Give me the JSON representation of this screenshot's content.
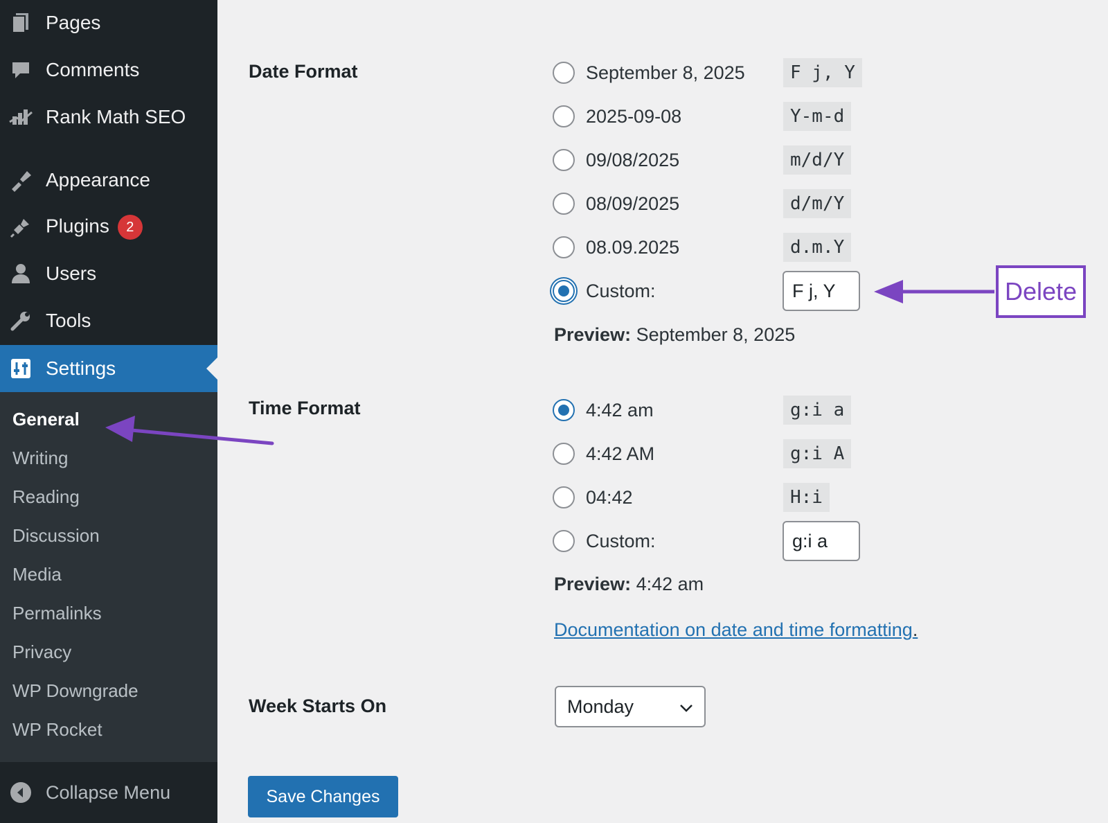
{
  "sidebar": {
    "menu": [
      {
        "label": "Pages",
        "icon": "pages-icon"
      },
      {
        "label": "Comments",
        "icon": "comments-icon"
      },
      {
        "label": "Rank Math SEO",
        "icon": "rank-math-icon"
      },
      {
        "label": "Appearance",
        "icon": "appearance-icon"
      },
      {
        "label": "Plugins",
        "icon": "plugins-icon",
        "badge": "2"
      },
      {
        "label": "Users",
        "icon": "users-icon"
      },
      {
        "label": "Tools",
        "icon": "tools-icon"
      },
      {
        "label": "Settings",
        "icon": "settings-icon",
        "active": true
      }
    ],
    "submenu": [
      {
        "label": "General",
        "current": true
      },
      {
        "label": "Writing"
      },
      {
        "label": "Reading"
      },
      {
        "label": "Discussion"
      },
      {
        "label": "Media"
      },
      {
        "label": "Permalinks"
      },
      {
        "label": "Privacy"
      },
      {
        "label": "WP Downgrade"
      },
      {
        "label": "WP Rocket"
      }
    ],
    "collapse_label": "Collapse Menu"
  },
  "date_format": {
    "label": "Date Format",
    "options": [
      {
        "display": "September 8, 2025",
        "code": "F j, Y"
      },
      {
        "display": "2025-09-08",
        "code": "Y-m-d"
      },
      {
        "display": "09/08/2025",
        "code": "m/d/Y"
      },
      {
        "display": "08/09/2025",
        "code": "d/m/Y"
      },
      {
        "display": "08.09.2025",
        "code": "d.m.Y"
      }
    ],
    "custom_label": "Custom:",
    "custom_value": "F j, Y",
    "preview_label": "Preview:",
    "preview_value": "September 8, 2025"
  },
  "time_format": {
    "label": "Time Format",
    "options": [
      {
        "display": "4:42 am",
        "code": "g:i a"
      },
      {
        "display": "4:42 AM",
        "code": "g:i A"
      },
      {
        "display": "04:42",
        "code": "H:i"
      }
    ],
    "custom_label": "Custom:",
    "custom_value": "g:i a",
    "preview_label": "Preview:",
    "preview_value": "4:42 am"
  },
  "documentation_link": "Documentation on date and time formatting",
  "documentation_period": ".",
  "week_starts_on": {
    "label": "Week Starts On",
    "selected": "Monday"
  },
  "save_button": "Save Changes",
  "annotation": {
    "delete_label": "Delete",
    "color": "#7b45c1"
  },
  "colors": {
    "sidebar_bg": "#1d2327",
    "submenu_bg": "#2c3338",
    "accent": "#2271b1",
    "badge": "#d63638"
  }
}
